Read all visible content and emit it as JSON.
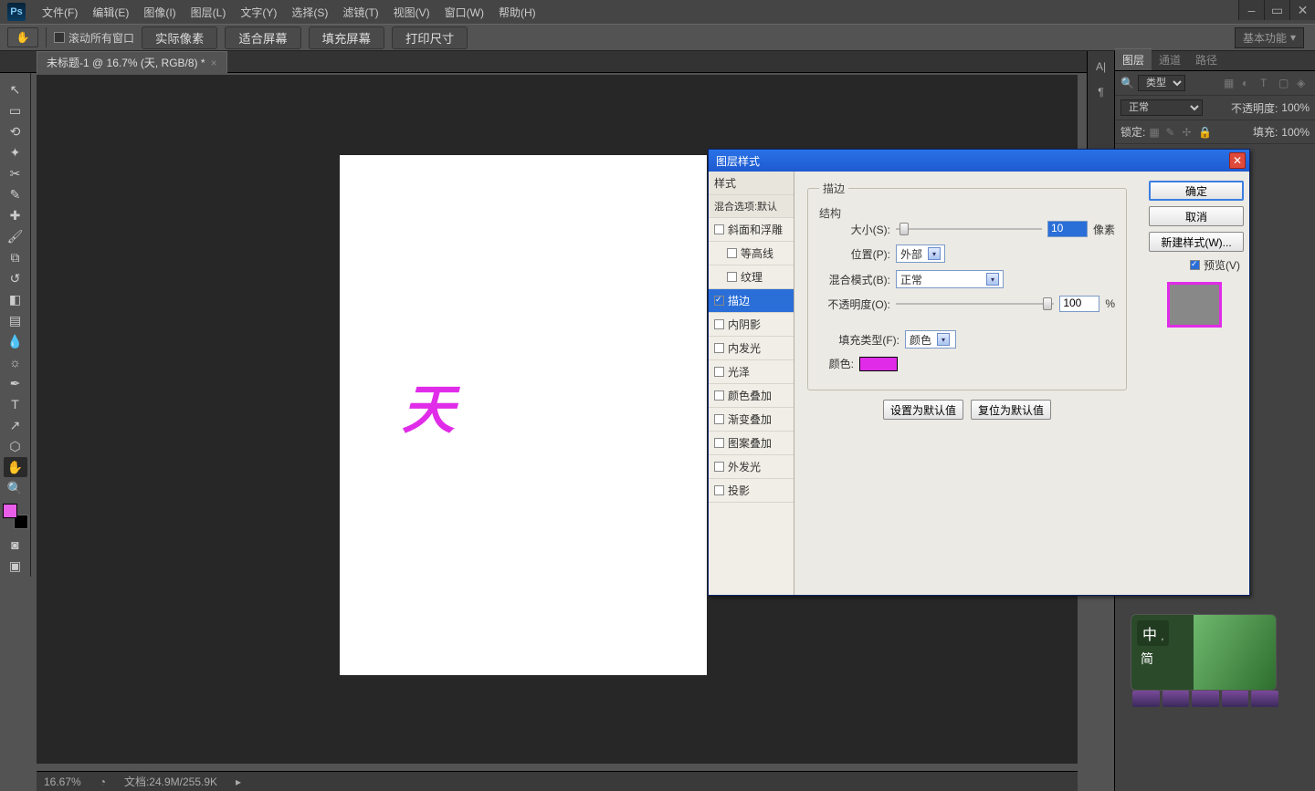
{
  "menu": {
    "items": [
      "文件(F)",
      "编辑(E)",
      "图像(I)",
      "图层(L)",
      "文字(Y)",
      "选择(S)",
      "滤镜(T)",
      "视图(V)",
      "窗口(W)",
      "帮助(H)"
    ]
  },
  "optbar": {
    "scroll_all": "滚动所有窗口",
    "btn_actual": "实际像素",
    "btn_fit": "适合屏幕",
    "btn_fill": "填充屏幕",
    "btn_print": "打印尺寸",
    "workspace": "基本功能"
  },
  "doctab": {
    "title": "未标题-1 @ 16.7% (天, RGB/8) *"
  },
  "canvas": {
    "glyph": "天"
  },
  "status": {
    "zoom": "16.67%",
    "docinfo": "文档:24.9M/255.9K"
  },
  "panels": {
    "tabs": [
      "图层",
      "通道",
      "路径"
    ],
    "kind_label": "类型",
    "blend": "正常",
    "opacity_label": "不透明度:",
    "opacity_val": "100%",
    "lock_label": "锁定:",
    "fill_label": "填充:",
    "fill_val": "100%"
  },
  "dialog": {
    "title": "图层样式",
    "styles_header": "样式",
    "blend_defaults": "混合选项:默认",
    "items": [
      {
        "label": "斜面和浮雕",
        "checked": false
      },
      {
        "label": "等高线",
        "checked": false,
        "indent": true
      },
      {
        "label": "纹理",
        "checked": false,
        "indent": true
      },
      {
        "label": "描边",
        "checked": true,
        "selected": true
      },
      {
        "label": "内阴影",
        "checked": false
      },
      {
        "label": "内发光",
        "checked": false
      },
      {
        "label": "光泽",
        "checked": false
      },
      {
        "label": "颜色叠加",
        "checked": false
      },
      {
        "label": "渐变叠加",
        "checked": false
      },
      {
        "label": "图案叠加",
        "checked": false
      },
      {
        "label": "外发光",
        "checked": false
      },
      {
        "label": "投影",
        "checked": false
      }
    ],
    "group_stroke": "描边",
    "group_struct": "结构",
    "size_label": "大小(S):",
    "size_val": "10",
    "size_unit": "像素",
    "pos_label": "位置(P):",
    "pos_val": "外部",
    "blend_label": "混合模式(B):",
    "blend_val": "正常",
    "opac_label": "不透明度(O):",
    "opac_val": "100",
    "opac_unit": "%",
    "fill_type_label": "填充类型(F):",
    "fill_type_val": "颜色",
    "color_label": "颜色:",
    "btn_set_default": "设置为默认值",
    "btn_reset_default": "复位为默认值",
    "btn_ok": "确定",
    "btn_cancel": "取消",
    "btn_newstyle": "新建样式(W)...",
    "preview_label": "预览(V)"
  },
  "ime": {
    "char": "中",
    "simp": "简"
  }
}
